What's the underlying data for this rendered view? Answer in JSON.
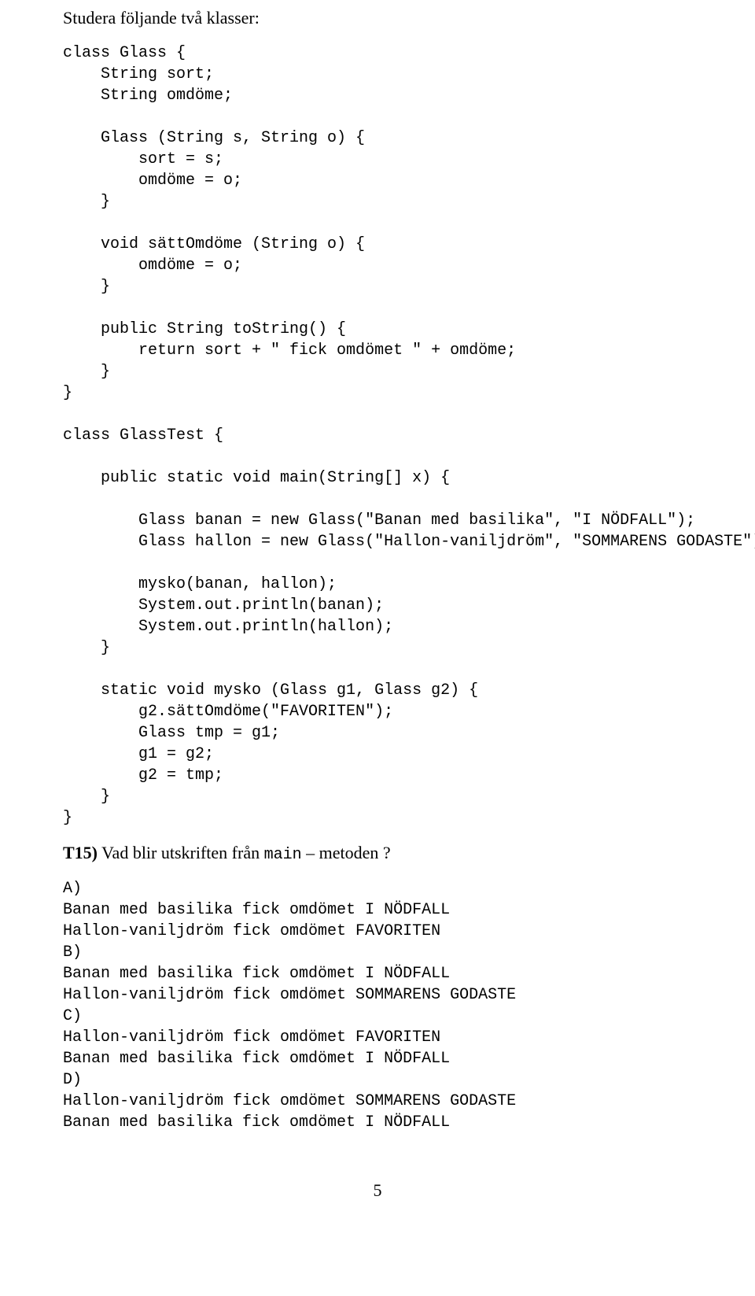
{
  "intro": "Studera följande två klasser:",
  "code": "class Glass {\n    String sort;\n    String omdöme;\n\n    Glass (String s, String o) {\n        sort = s;\n        omdöme = o;\n    }\n\n    void sättOmdöme (String o) {\n        omdöme = o;\n    }\n\n    public String toString() {\n        return sort + \" fick omdömet \" + omdöme;\n    }\n}\n\nclass GlassTest {\n\n    public static void main(String[] x) {\n\n        Glass banan = new Glass(\"Banan med basilika\", \"I NÖDFALL\");\n        Glass hallon = new Glass(\"Hallon-vaniljdröm\", \"SOMMARENS GODASTE\");\n\n        mysko(banan, hallon);\n        System.out.println(banan);\n        System.out.println(hallon);\n    }\n\n    static void mysko (Glass g1, Glass g2) {\n        g2.sättOmdöme(\"FAVORITEN\");\n        Glass tmp = g1;\n        g1 = g2;\n        g2 = tmp;\n    }\n}",
  "question": {
    "label": "T15)",
    "text_before": " Vad blir utskriften från ",
    "mono": "main",
    "text_after": " – metoden ?"
  },
  "answers": "A)\nBanan med basilika fick omdömet I NÖDFALL\nHallon-vaniljdröm fick omdömet FAVORITEN\nB)\nBanan med basilika fick omdömet I NÖDFALL\nHallon-vaniljdröm fick omdömet SOMMARENS GODASTE\nC)\nHallon-vaniljdröm fick omdömet FAVORITEN\nBanan med basilika fick omdömet I NÖDFALL\nD)\nHallon-vaniljdröm fick omdömet SOMMARENS GODASTE\nBanan med basilika fick omdömet I NÖDFALL",
  "page_number": "5"
}
